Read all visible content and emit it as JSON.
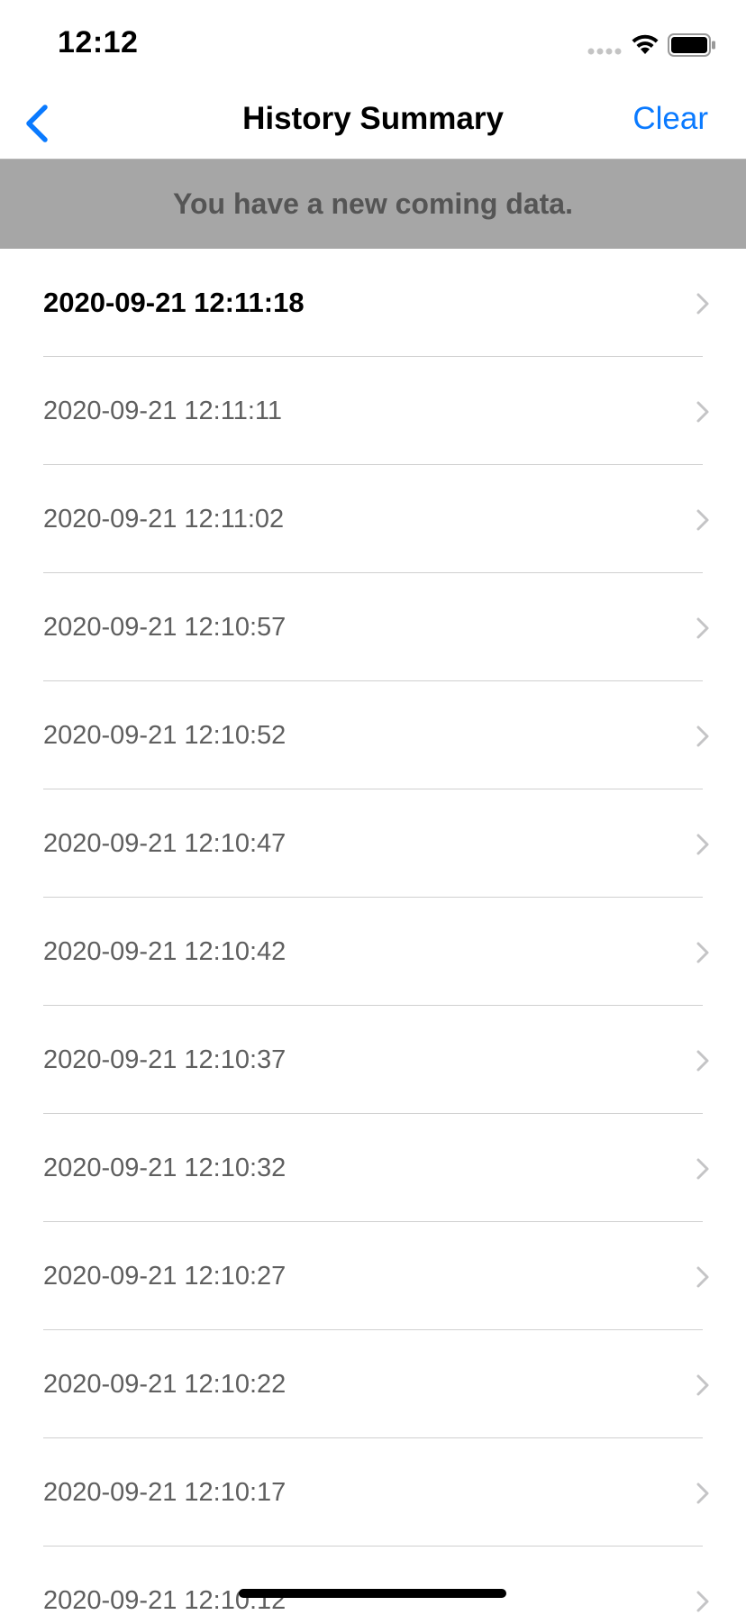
{
  "status_bar": {
    "time": "12:12"
  },
  "nav": {
    "title": "History Summary",
    "clear_label": "Clear"
  },
  "banner": {
    "message": "You have a new coming data."
  },
  "history": {
    "items": [
      {
        "label": "2020-09-21 12:11:18"
      },
      {
        "label": "2020-09-21 12:11:11"
      },
      {
        "label": "2020-09-21 12:11:02"
      },
      {
        "label": "2020-09-21 12:10:57"
      },
      {
        "label": "2020-09-21 12:10:52"
      },
      {
        "label": "2020-09-21 12:10:47"
      },
      {
        "label": "2020-09-21 12:10:42"
      },
      {
        "label": "2020-09-21 12:10:37"
      },
      {
        "label": "2020-09-21 12:10:32"
      },
      {
        "label": "2020-09-21 12:10:27"
      },
      {
        "label": "2020-09-21 12:10:22"
      },
      {
        "label": "2020-09-21 12:10:17"
      },
      {
        "label": "2020-09-21 12:10:12"
      }
    ]
  },
  "colors": {
    "accent": "#0a7aff",
    "banner_bg": "#a6a6a6",
    "banner_text": "#555555"
  }
}
